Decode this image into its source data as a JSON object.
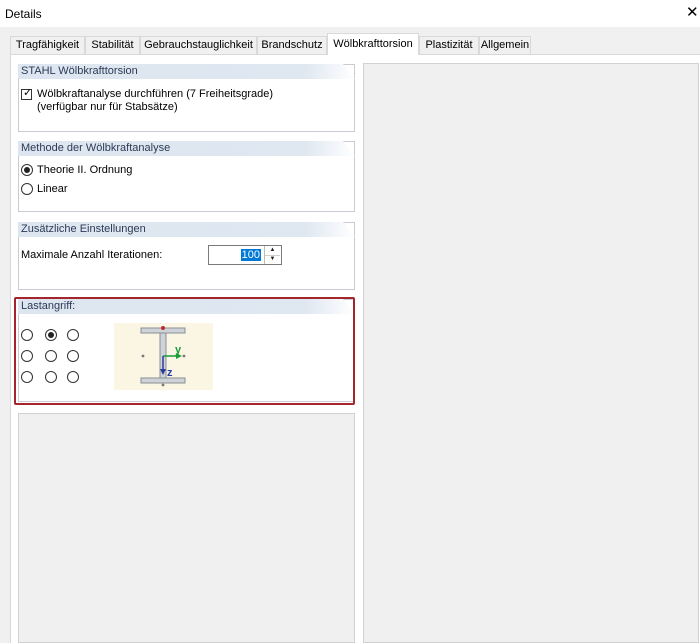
{
  "window": {
    "title": "Details",
    "close_glyph": "✕"
  },
  "tabs": [
    {
      "label": "Tragfähigkeit"
    },
    {
      "label": "Stabilität"
    },
    {
      "label": "Gebrauchstauglichkeit"
    },
    {
      "label": "Brandschutz"
    },
    {
      "label": "Wölbkrafttorsion",
      "active": true
    },
    {
      "label": "Plastizität"
    },
    {
      "label": "Allgemein"
    }
  ],
  "stahl_group": {
    "title": "STAHL Wölbkrafttorsion",
    "checkbox_label_line1": "Wölbkraftanalyse durchführen (7 Freiheitsgrade)",
    "checkbox_label_line2": "(verfügbar nur für Stabsätze)",
    "checked": true
  },
  "method_group": {
    "title": "Methode der Wölbkraftanalyse",
    "options": [
      "Theorie II. Ordnung",
      "Linear"
    ],
    "selected": "Theorie II. Ordnung"
  },
  "settings_group": {
    "title": "Zusätzliche Einstellungen",
    "max_iterations_label": "Maximale Anzahl Iterationen:",
    "max_iterations_value": "100"
  },
  "load_group": {
    "title": "Lastangriff:",
    "selected_row": 1,
    "selected_col": 2,
    "axis_y": "y",
    "axis_z": "z"
  },
  "colors": {
    "highlight_border": "#a4262c",
    "group_header_text": "#2b3a55",
    "axis_y": "#1a9c3a",
    "axis_z": "#2b3d9c"
  }
}
